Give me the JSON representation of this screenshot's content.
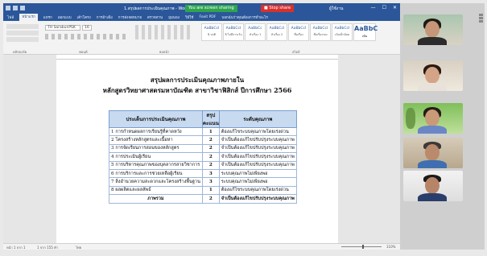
{
  "window": {
    "doc_title": "1.สรุปผลการประเมินคุณภาพ - Word",
    "zoom_banner": "You are screen sharing",
    "stop_share": "■ Stop share",
    "user": "ผู้ใช้งาน"
  },
  "ribbon": {
    "tabs": [
      "ไฟล์",
      "หน้าแรก",
      "แทรก",
      "ออกแบบ",
      "เค้าโครง",
      "การอ้างอิง",
      "การส่งจดหมาย",
      "ตรวจทาน",
      "มุมมอง",
      "วิธีใช้",
      "Foxit PDF",
      "บอกฉันว่าคุณต้องการทำอะไร"
    ],
    "active_tab": "หน้าแรก",
    "font_name": "TH SarabunPSK",
    "font_size": "16",
    "styles": [
      {
        "sample": "AaBbCcI",
        "name": "¶ ปกติ"
      },
      {
        "sample": "AaBbCcI",
        "name": "¶ ไม่มีการเว้น"
      },
      {
        "sample": "AaBbCc",
        "name": "หัวเรื่อง 1"
      },
      {
        "sample": "AaBbCcI",
        "name": "หัวเรื่อง 2"
      },
      {
        "sample": "AaBbCcI",
        "name": "ชื่อเรื่อง"
      },
      {
        "sample": "AaBbCcI",
        "name": "ชื่อเรื่องรอง"
      },
      {
        "sample": "AaBbCcI",
        "name": "เน้นเล็กน้อย"
      },
      {
        "sample": "AaBbC",
        "name": "เน้น"
      }
    ],
    "group_labels": [
      "คลิปบอร์ด",
      "ฟอนต์",
      "ย่อหน้า",
      "สไตล์"
    ]
  },
  "document": {
    "heading_line1": "สรุปผลการประเมินคุณภาพภายใน",
    "heading_line2": "หลักสูตรวิทยาศาสตรมหาบัณฑิต สาขาวิชาฟิสิกส์ ปีการศึกษา 2566",
    "table": {
      "headers": [
        "ประเด็นการประเมินคุณภาพ",
        "สรุปคะแนน",
        "ระดับคุณภาพ"
      ],
      "rows": [
        [
          "1 การกำหนดผลการเรียนรู้ที่คาดหวัง",
          "1",
          "ต้องแก้ไขระบบคุณภาพโดยเร่งด่วน"
        ],
        [
          "2 โครงสร้างหลักสูตรและเนื้อหา",
          "2",
          "จำเป็นต้องแก้ไขปรับปรุงระบบคุณภาพ"
        ],
        [
          "3 การจัดเรียนการสอนของหลักสูตร",
          "2",
          "จำเป็นต้องแก้ไขปรับปรุงระบบคุณภาพ"
        ],
        [
          "4 การประเมินผู้เรียน",
          "2",
          "จำเป็นต้องแก้ไขปรับปรุงระบบคุณภาพ"
        ],
        [
          "5 การบริหารคุณภาพของบุคลากรสายวิชาการ",
          "2",
          "จำเป็นต้องแก้ไขปรับปรุงระบบคุณภาพ"
        ],
        [
          "6 การบริการและการช่วยเหลือผู้เรียน",
          "3",
          "ระบบคุณภาพไม่เพียงพอ"
        ],
        [
          "7 สิ่งอำนวยความสะดวกและโครงสร้างพื้นฐาน",
          "3",
          "ระบบคุณภาพไม่เพียงพอ"
        ],
        [
          "8 ผลผลิตและผลลัพธ์",
          "1",
          "ต้องแก้ไขระบบคุณภาพโดยเร่งด่วน"
        ]
      ],
      "total": [
        "ภาพรวม",
        "2",
        "จำเป็นต้องแก้ไขปรับปรุงระบบคุณภาพ"
      ]
    }
  },
  "statusbar": {
    "page": "หน้า 1 จาก 1",
    "words": "1 จาก 155 คำ",
    "language": "ไทย",
    "zoom": "110%"
  },
  "colors": {
    "word_blue": "#2b579a",
    "table_header": "#c7daf0",
    "share_green": "#2ea44f",
    "stop_red": "#d9302c"
  }
}
